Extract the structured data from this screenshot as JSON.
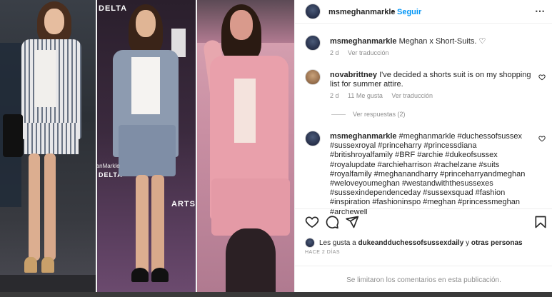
{
  "photo": {
    "watermark": "MsMeghanMarkle",
    "brand_text_1": "DELTA",
    "brand_text_2": "DELTA",
    "side_text": "ARTS"
  },
  "post": {
    "author": "msmeghanmarkle",
    "separator": "•",
    "follow_label": "Seguir",
    "more_icon": "⋯"
  },
  "comments": [
    {
      "user": "msmeghanmarkle",
      "text": "Meghan x Short-Suits.",
      "emoji": "♡",
      "age": "2 d",
      "translate": "Ver traducción"
    },
    {
      "user": "novabrittney",
      "text": "I've decided a shorts suit is on my shopping list for summer attire.",
      "age": "2 d",
      "likes": "11 Me gusta",
      "translate": "Ver traducción",
      "replies": "Ver respuestas (2)"
    },
    {
      "user": "msmeghanmarkle",
      "text": "#meghanmarkle #duchessofsussex #sussexroyal #princeharry #princessdiana #britishroyalfamily #BRF #archie #dukeofsussex #royalupdate #archieharrison #rachelzane #suits #royalfamily #meghanandharry #princeharryandmeghan #weloveyoumeghan #westandwiththesussexes #sussexindependenceday #sussexsquad #fashion #inspiration #fashioninspo #meghan #princessmeghan #archewell"
    }
  ],
  "actions": {
    "like_icon": "heart-icon",
    "comment_icon": "comment-icon",
    "share_icon": "send-icon",
    "save_icon": "bookmark-icon"
  },
  "likes": {
    "prefix": "Les gusta a",
    "user": "dukeandduchessofsussexdaily",
    "joiner": "y",
    "others": "otras personas"
  },
  "timestamp": "HACE 2 DÍAS",
  "comments_limited": "Se limitaron los comentarios en esta publicación.",
  "colors": {
    "accent": "#0095f6",
    "hashtag": "#00376b",
    "muted": "#8e8e8e"
  }
}
